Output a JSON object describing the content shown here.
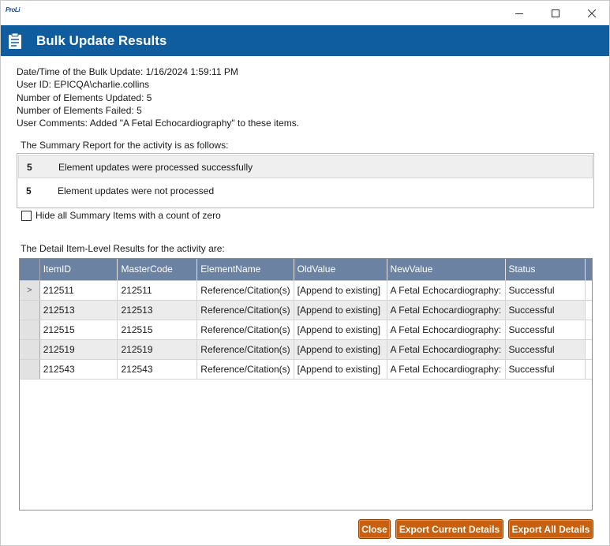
{
  "titlebar": {
    "app_logo_text": "ProLi"
  },
  "header": {
    "title": "Bulk Update Results"
  },
  "info": {
    "datetime": "Date/Time of the Bulk Update: 1/16/2024 1:59:11 PM",
    "user_id": "User ID: EPICQA\\charlie.collins",
    "updated": "Number of Elements Updated: 5",
    "failed": "Number of Elements Failed: 5",
    "comments": "User Comments: Added \"A Fetal Echocardiography\" to these items."
  },
  "summary": {
    "label": "The Summary Report for the activity is as follows:",
    "rows": [
      {
        "count": "5",
        "text": "Element updates were processed successfully"
      },
      {
        "count": "5",
        "text": "Element updates were not processed"
      }
    ],
    "hide_zero_label": "Hide all Summary Items with a count of zero",
    "hide_zero_checked": false
  },
  "details": {
    "label": "The Detail Item-Level Results for the activity are:",
    "columns": [
      "ItemID",
      "MasterCode",
      "ElementName",
      "OldValue",
      "NewValue",
      "Status"
    ],
    "current_row_marker": ">",
    "rows": [
      [
        "212511",
        "212511",
        "Reference/Citation(s)",
        "[Append to existing]",
        "A Fetal Echocardiography:",
        "Successful"
      ],
      [
        "212513",
        "212513",
        "Reference/Citation(s)",
        "[Append to existing]",
        "A Fetal Echocardiography:",
        "Successful"
      ],
      [
        "212515",
        "212515",
        "Reference/Citation(s)",
        "[Append to existing]",
        "A Fetal Echocardiography:",
        "Successful"
      ],
      [
        "212519",
        "212519",
        "Reference/Citation(s)",
        "[Append to existing]",
        "A Fetal Echocardiography:",
        "Successful"
      ],
      [
        "212543",
        "212543",
        "Reference/Citation(s)",
        "[Append to existing]",
        "A Fetal Echocardiography:",
        "Successful"
      ]
    ]
  },
  "buttons": {
    "close": "Close",
    "export_current": "Export Current Details",
    "export_all": "Export All Details"
  },
  "colors": {
    "header_bg": "#0f5d9e",
    "grid_header_bg": "#6b82a3",
    "button_bg": "#c8600f"
  }
}
